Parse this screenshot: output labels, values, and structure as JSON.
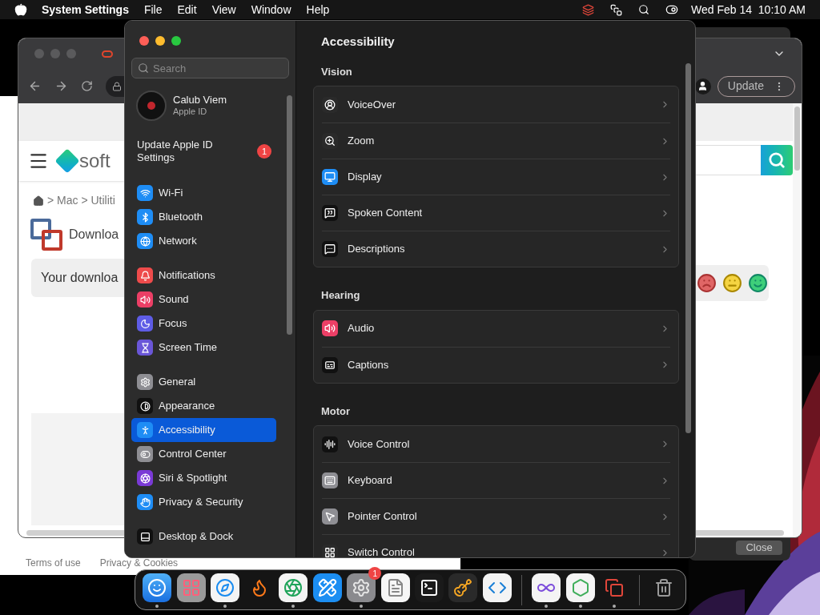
{
  "menu_bar": {
    "app": "System Settings",
    "menus": [
      "File",
      "Edit",
      "View",
      "Window",
      "Help"
    ],
    "clock": "Wed Feb 14  10:10 AM"
  },
  "browser": {
    "logo_text": "soft",
    "breadcrumb": "> Mac > Utiliti",
    "heading": "Downloa",
    "notice": "Your downloa",
    "update_button": "Update"
  },
  "behind_window": {
    "footer_links": [
      "Terms of use",
      "Privacy & Cookies"
    ],
    "close_button": "Close"
  },
  "settings": {
    "search": {
      "placeholder": "Search"
    },
    "account": {
      "name": "Calub Viem",
      "subtitle": "Apple ID"
    },
    "update_notice": {
      "label": "Update Apple ID Settings",
      "badge": "1"
    },
    "sidebar_groups": [
      [
        {
          "label": "Wi-Fi",
          "selected": false
        },
        {
          "label": "Bluetooth",
          "selected": false
        },
        {
          "label": "Network",
          "selected": false
        }
      ],
      [
        {
          "label": "Notifications",
          "selected": false
        },
        {
          "label": "Sound",
          "selected": false
        },
        {
          "label": "Focus",
          "selected": false
        },
        {
          "label": "Screen Time",
          "selected": false
        }
      ],
      [
        {
          "label": "General",
          "selected": false
        },
        {
          "label": "Appearance",
          "selected": false
        },
        {
          "label": "Accessibility",
          "selected": true
        },
        {
          "label": "Control Center",
          "selected": false
        },
        {
          "label": "Siri & Spotlight",
          "selected": false
        },
        {
          "label": "Privacy & Security",
          "selected": false
        }
      ],
      [
        {
          "label": "Desktop & Dock",
          "selected": false
        }
      ]
    ],
    "title": "Accessibility",
    "sections": [
      {
        "heading": "Vision",
        "rows": [
          "VoiceOver",
          "Zoom",
          "Display",
          "Spoken Content",
          "Descriptions"
        ]
      },
      {
        "heading": "Hearing",
        "rows": [
          "Audio",
          "Captions"
        ]
      },
      {
        "heading": "Motor",
        "rows": [
          "Voice Control",
          "Keyboard",
          "Pointer Control",
          "Switch Control"
        ]
      }
    ]
  },
  "dock": {
    "groups": [
      [
        {
          "running": true
        },
        {
          "running": false
        },
        {
          "running": true
        },
        {
          "running": false
        },
        {
          "running": true
        },
        {
          "running": false
        },
        {
          "running": true,
          "badge": "1"
        },
        {
          "running": false
        },
        {
          "running": false
        },
        {
          "running": false
        },
        {
          "running": false
        }
      ],
      [
        {
          "running": true
        },
        {
          "running": true
        },
        {
          "running": true
        }
      ],
      [
        {
          "running": false
        }
      ]
    ]
  }
}
